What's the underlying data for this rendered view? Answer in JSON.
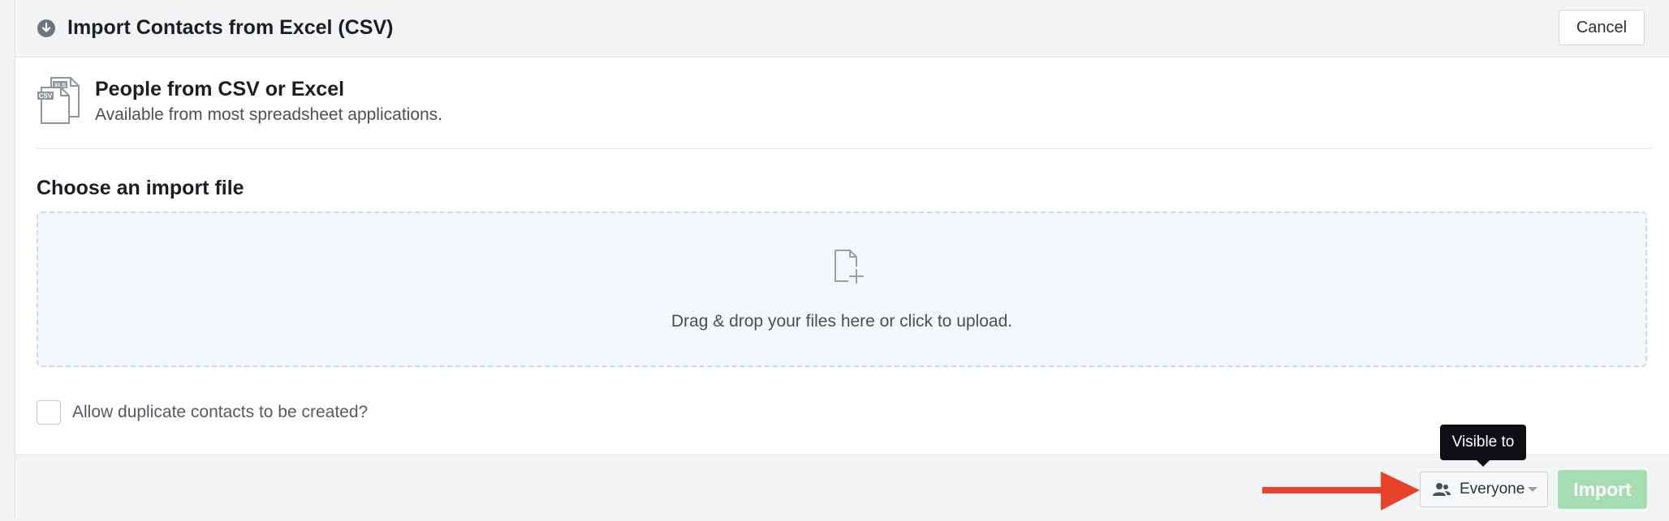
{
  "header": {
    "title": "Import Contacts from Excel (CSV)",
    "cancel_label": "Cancel"
  },
  "source": {
    "title": "People from CSV or Excel",
    "description": "Available from most spreadsheet applications.",
    "icon_labels": [
      "XLS",
      "CSV"
    ]
  },
  "section": {
    "title": "Choose an import file"
  },
  "dropzone": {
    "text": "Drag & drop your files here or click to upload."
  },
  "options": {
    "allow_duplicates_label": "Allow duplicate contacts to be created?",
    "allow_duplicates_checked": false
  },
  "footer": {
    "tooltip": "Visible to",
    "visibility_value": "Everyone",
    "import_label": "Import"
  },
  "colors": {
    "import_button": "#a6ddb3",
    "arrow": "#e8432a",
    "tooltip_bg": "#0d0f12"
  },
  "icons": {
    "header": "download-circle-icon",
    "source": "csv-xls-file-icon",
    "dropzone": "file-add-icon",
    "visibility": "people-icon",
    "dropdown": "caret-down-icon"
  }
}
